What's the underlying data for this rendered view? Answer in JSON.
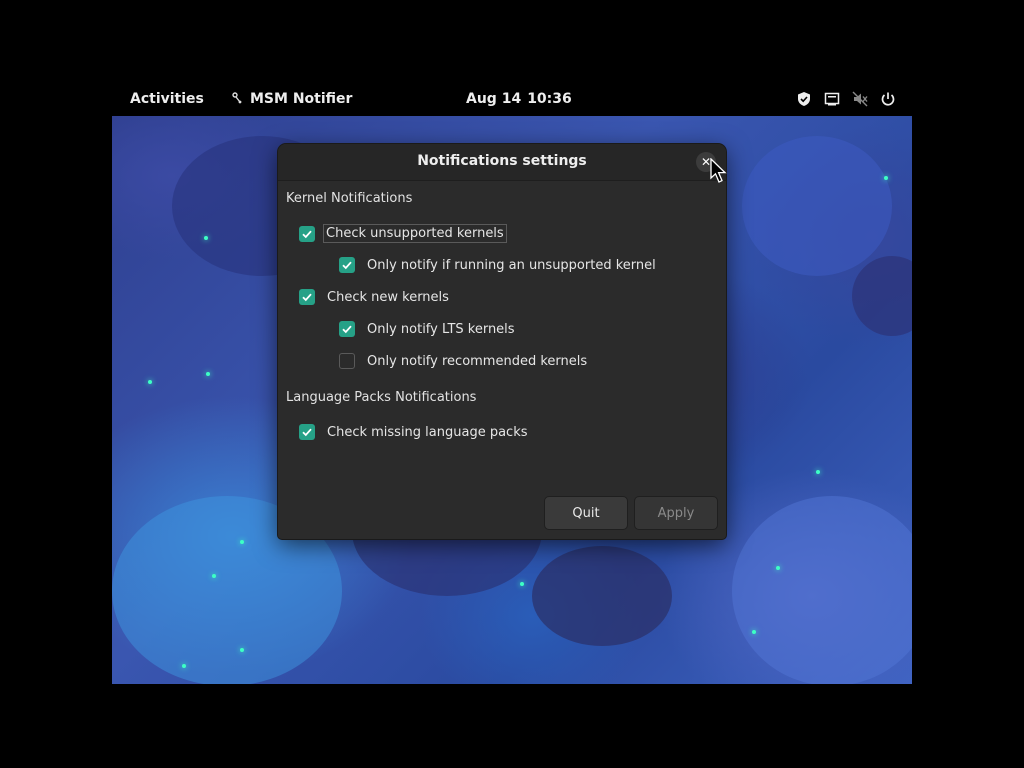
{
  "topbar": {
    "activities_label": "Activities",
    "app_name": "MSM Notifier",
    "app_icon": "msm-icon",
    "date": "Aug 14",
    "time": "10:36",
    "tray_icons": [
      "shield-icon",
      "network-icon",
      "volume-muted-icon",
      "power-icon"
    ]
  },
  "dialog": {
    "title": "Notifications settings",
    "close_symbol": "✕",
    "kernel_section": {
      "title": "Kernel Notifications",
      "check_unsupported": {
        "label": "Check unsupported kernels",
        "checked": true
      },
      "only_running_unsupported": {
        "label": "Only notify if running an unsupported kernel",
        "checked": true
      },
      "check_new": {
        "label": "Check new kernels",
        "checked": true
      },
      "only_lts": {
        "label": "Only notify LTS kernels",
        "checked": true
      },
      "only_recommended": {
        "label": "Only notify recommended kernels",
        "checked": false
      }
    },
    "language_section": {
      "title": "Language Packs Notifications",
      "check_missing": {
        "label": "Check missing language packs",
        "checked": true
      }
    },
    "buttons": {
      "quit_label": "Quit",
      "apply_label": "Apply"
    }
  },
  "colors": {
    "accent": "#26a187",
    "dialog_bg": "#2b2b2b",
    "desktop_blue": "#3a56b0",
    "speck_green": "#3dffc5"
  }
}
